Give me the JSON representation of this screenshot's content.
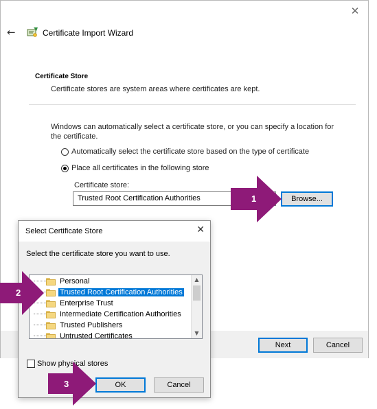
{
  "wizard": {
    "title": "Certificate Import Wizard",
    "section_title": "Certificate Store",
    "section_desc": "Certificate stores are system areas where certificates are kept.",
    "paragraph": "Windows can automatically select a certificate store, or you can specify a location for the certificate.",
    "radio_auto": "Automatically select the certificate store based on the type of certificate",
    "radio_place": "Place all certificates in the following store",
    "store_label": "Certificate store:",
    "store_value": "Trusted Root Certification Authorities",
    "browse_label": "Browse...",
    "next_label": "Next",
    "cancel_label": "Cancel"
  },
  "dialog": {
    "title": "Select Certificate Store",
    "instruction": "Select the certificate store you want to use.",
    "stores": [
      {
        "label": "Personal"
      },
      {
        "label": "Trusted Root Certification Authorities"
      },
      {
        "label": "Enterprise Trust"
      },
      {
        "label": "Intermediate Certification Authorities"
      },
      {
        "label": "Trusted Publishers"
      },
      {
        "label": "Untrusted Certificates"
      }
    ],
    "selected_index": 1,
    "show_physical": "Show physical stores",
    "ok_label": "OK",
    "cancel_label": "Cancel"
  },
  "annotations": {
    "step1": "1",
    "step2": "2",
    "step3": "3",
    "color": "#8e1a78"
  },
  "colors": {
    "accent": "#0078d7",
    "folder": "#f5d77f"
  }
}
